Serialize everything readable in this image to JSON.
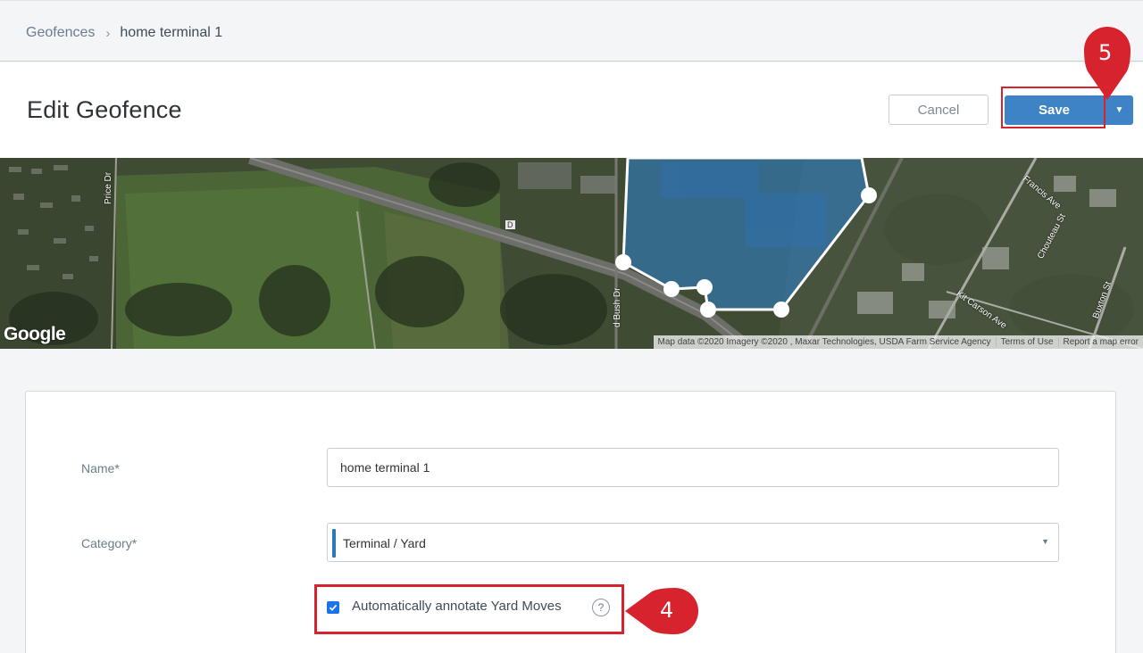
{
  "breadcrumb": {
    "parent": "Geofences",
    "separator": "›",
    "current": "home terminal 1"
  },
  "header": {
    "title": "Edit Geofence",
    "cancel_label": "Cancel",
    "save_label": "Save",
    "save_menu_icon": "caret-down-icon"
  },
  "map": {
    "logo": "Google",
    "attribution": [
      "Map data ©2020 Imagery ©2020 , Maxar Technologies, USDA Farm Service Agency",
      "Terms of Use",
      "Report a map error"
    ],
    "street_labels": {
      "price": "Price Dr",
      "bush": "d Bush Dr",
      "francis": "Francis Ave",
      "chouteau": "Chouteau St",
      "kit_carson": "Kit Carson Ave",
      "buxton": "Buxton St",
      "route": "D"
    },
    "geofence_fill": "#2f7fc6"
  },
  "form": {
    "name_label": "Name*",
    "name_value": "home terminal 1",
    "category_label": "Category*",
    "category_value": "Terminal / Yard",
    "category_color": "#2a7ab8",
    "yard_moves_label": "Automatically annotate Yard Moves",
    "yard_moves_checked": true,
    "help_glyph": "?"
  },
  "callouts": {
    "step4": "4",
    "step5": "5",
    "color": "#d7232e"
  }
}
